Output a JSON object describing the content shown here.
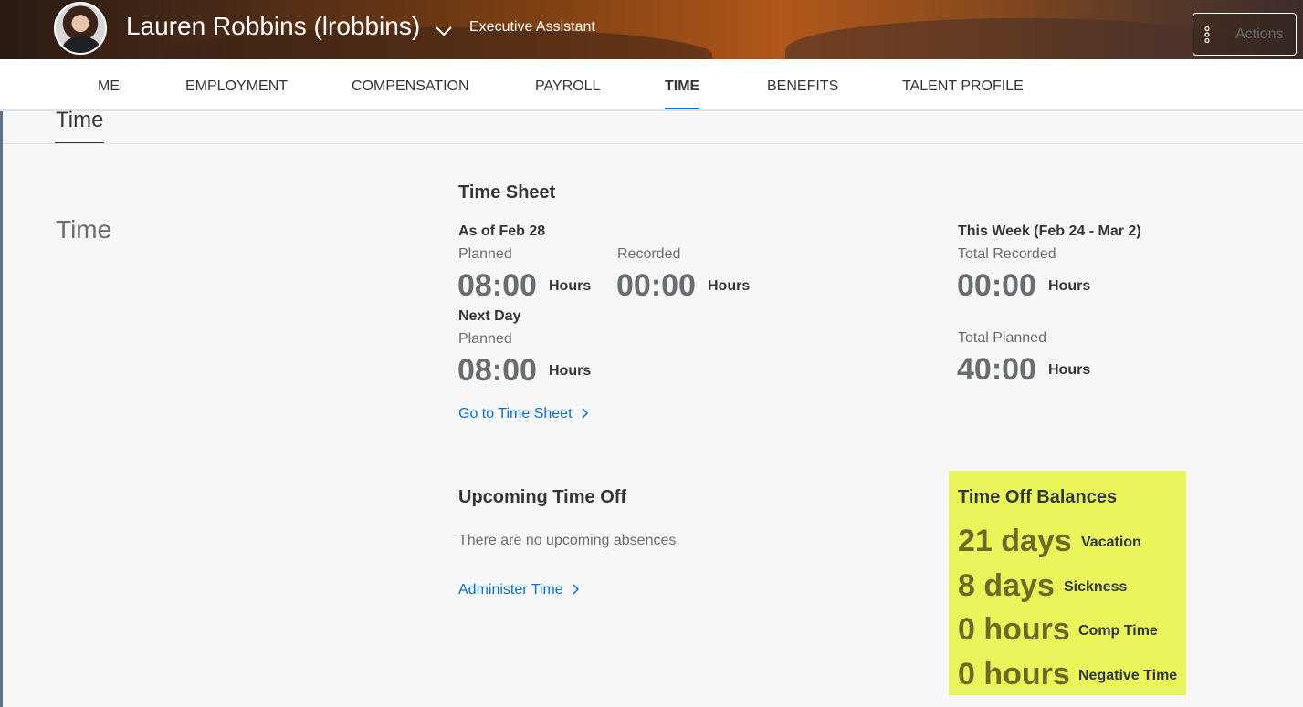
{
  "header": {
    "user_name": "Lauren Robbins (lrobbins)",
    "job_title": "Executive Assistant",
    "actions_label": "Actions"
  },
  "tabs": [
    {
      "label": "ME",
      "active": false
    },
    {
      "label": "EMPLOYMENT",
      "active": false
    },
    {
      "label": "COMPENSATION",
      "active": false
    },
    {
      "label": "PAYROLL",
      "active": false
    },
    {
      "label": "TIME",
      "active": true
    },
    {
      "label": "BENEFITS",
      "active": false
    },
    {
      "label": "TALENT PROFILE",
      "active": false
    }
  ],
  "section": {
    "header": "Time",
    "subsection_title": "Time"
  },
  "time_sheet": {
    "title": "Time Sheet",
    "as_of": "As of Feb 28",
    "planned_label": "Planned",
    "planned_value": "08:00",
    "recorded_label": "Recorded",
    "recorded_value": "00:00",
    "unit": "Hours",
    "next_day": "Next Day",
    "next_planned_label": "Planned",
    "next_planned_value": "08:00",
    "week_title": "This Week (Feb 24 - Mar 2)",
    "total_recorded_label": "Total Recorded",
    "total_recorded_value": "00:00",
    "total_planned_label": "Total Planned",
    "total_planned_value": "40:00",
    "link": "Go to Time Sheet"
  },
  "upcoming": {
    "title": "Upcoming Time Off",
    "empty_text": "There are no upcoming absences.",
    "link": "Administer Time"
  },
  "balances": {
    "title": "Time Off Balances",
    "highlight_color": "#e9f55a",
    "items": [
      {
        "value": "21 days",
        "label": "Vacation"
      },
      {
        "value": "8 days",
        "label": "Sickness"
      },
      {
        "value": "0 hours",
        "label": "Comp Time"
      },
      {
        "value": "0 hours",
        "label": "Negative Time"
      }
    ]
  },
  "colors": {
    "accent": "#0a6ed1",
    "text": "#32363a",
    "muted": "#6a6d70"
  }
}
